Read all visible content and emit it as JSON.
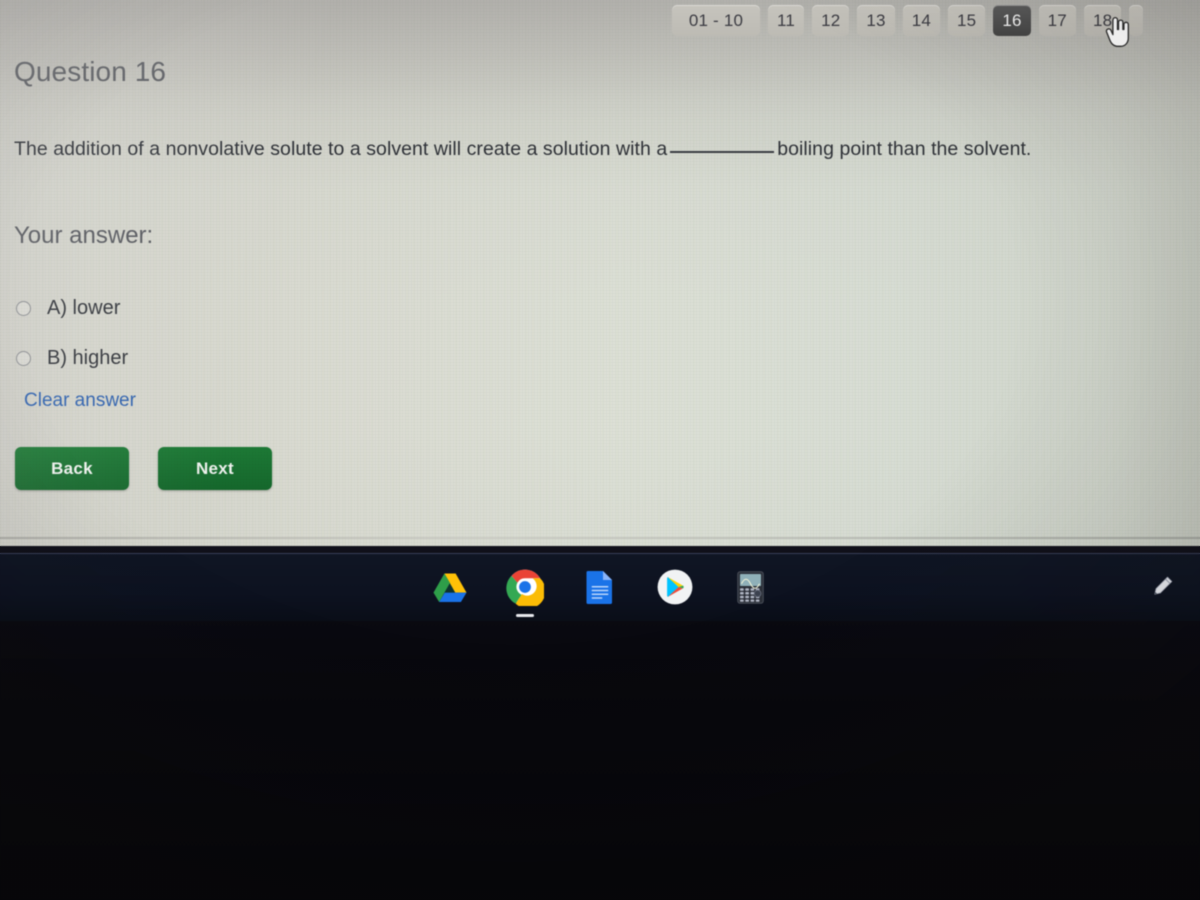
{
  "nav": {
    "buttons": [
      {
        "label": "01 - 10",
        "state": "normal",
        "wide": true
      },
      {
        "label": "11",
        "state": "normal",
        "wide": false
      },
      {
        "label": "12",
        "state": "normal",
        "wide": false
      },
      {
        "label": "13",
        "state": "normal",
        "wide": false
      },
      {
        "label": "14",
        "state": "normal",
        "wide": false
      },
      {
        "label": "15",
        "state": "normal",
        "wide": false
      },
      {
        "label": "16",
        "state": "active",
        "wide": false
      },
      {
        "label": "17",
        "state": "normal",
        "wide": false
      },
      {
        "label": "18",
        "state": "normal",
        "wide": false
      }
    ],
    "cursor_over_label": "17",
    "active_label": "16",
    "active_bg": "#4a4a4a",
    "normal_bg": "#c2c0b9"
  },
  "question": {
    "heading": "Question 16",
    "text_before_blank": "The addition of a nonvolative solute to a solvent will create a solution with a",
    "text_after_blank": "boiling point than the solvent.",
    "answer_label": "Your answer:",
    "options": [
      {
        "label": "A) lower",
        "selected": false
      },
      {
        "label": "B) higher",
        "selected": false
      }
    ],
    "clear_answer_label": "Clear answer",
    "clear_answer_color": "#2f62b0"
  },
  "actions": {
    "back_label": "Back",
    "next_label": "Next",
    "button_color": "#1a7232"
  },
  "taskbar": {
    "background": "#0d1220",
    "icons": [
      {
        "name": "google-drive-icon",
        "label": "Google Drive",
        "active": false
      },
      {
        "name": "chrome-icon",
        "label": "Google Chrome",
        "active": true
      },
      {
        "name": "google-docs-icon",
        "label": "Google Docs",
        "active": false
      },
      {
        "name": "google-play-icon",
        "label": "Google Play Store",
        "active": false
      },
      {
        "name": "calculator-icon",
        "label": "Graphing Calculator",
        "active": false
      }
    ],
    "tray": [
      {
        "name": "stylus-icon",
        "label": "Stylus"
      }
    ]
  }
}
